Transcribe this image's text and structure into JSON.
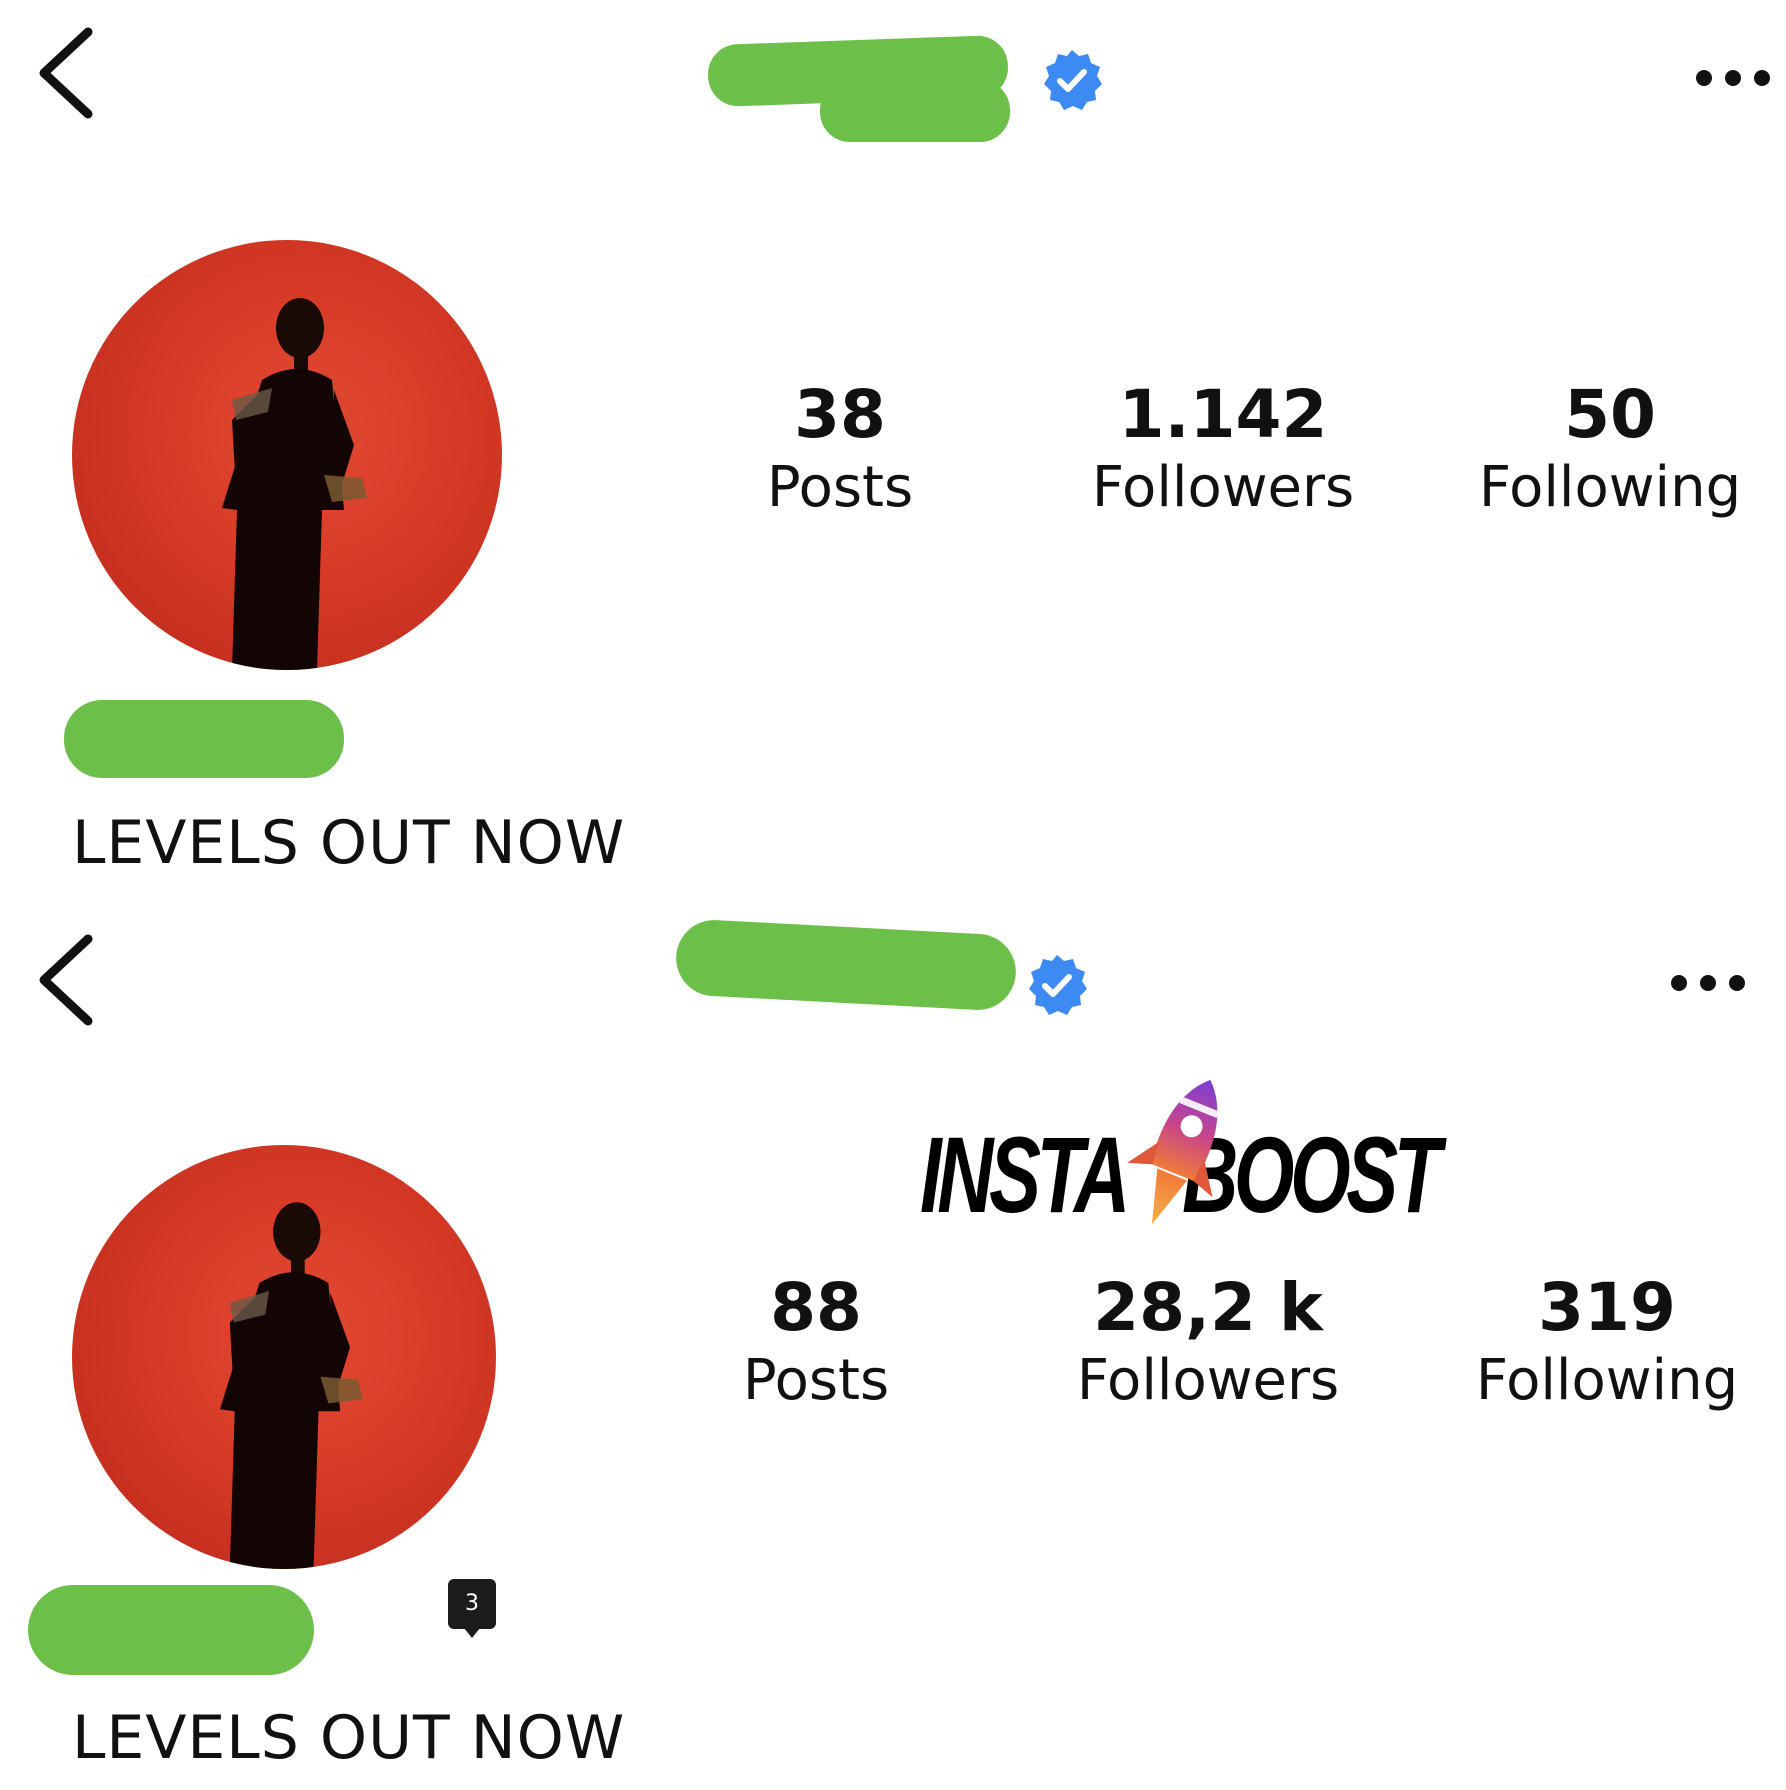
{
  "colors": {
    "verified_blue": "#3d8bf2",
    "redaction_green": "#6cc04a",
    "avatar_red": "#d63a26",
    "text": "#111111"
  },
  "icons": {
    "back": "chevron-left-icon",
    "more": "more-horizontal-icon",
    "verified": "verified-badge-icon",
    "rocket": "rocket-icon"
  },
  "before": {
    "stats": {
      "posts_value": "38",
      "posts_label": "Posts",
      "followers_value": "1.142",
      "followers_label": "Followers",
      "following_value": "50",
      "following_label": "Following"
    },
    "bio": "LEVELS OUT NOW"
  },
  "after": {
    "stats": {
      "posts_value": "88",
      "posts_label": "Posts",
      "followers_value": "28,2 k",
      "followers_label": "Followers",
      "following_value": "319",
      "following_label": "Following"
    },
    "bio": "LEVELS OUT NOW"
  },
  "logo": {
    "part1": "INSTA",
    "part2": "BOOST"
  },
  "badge": {
    "count": "3"
  }
}
